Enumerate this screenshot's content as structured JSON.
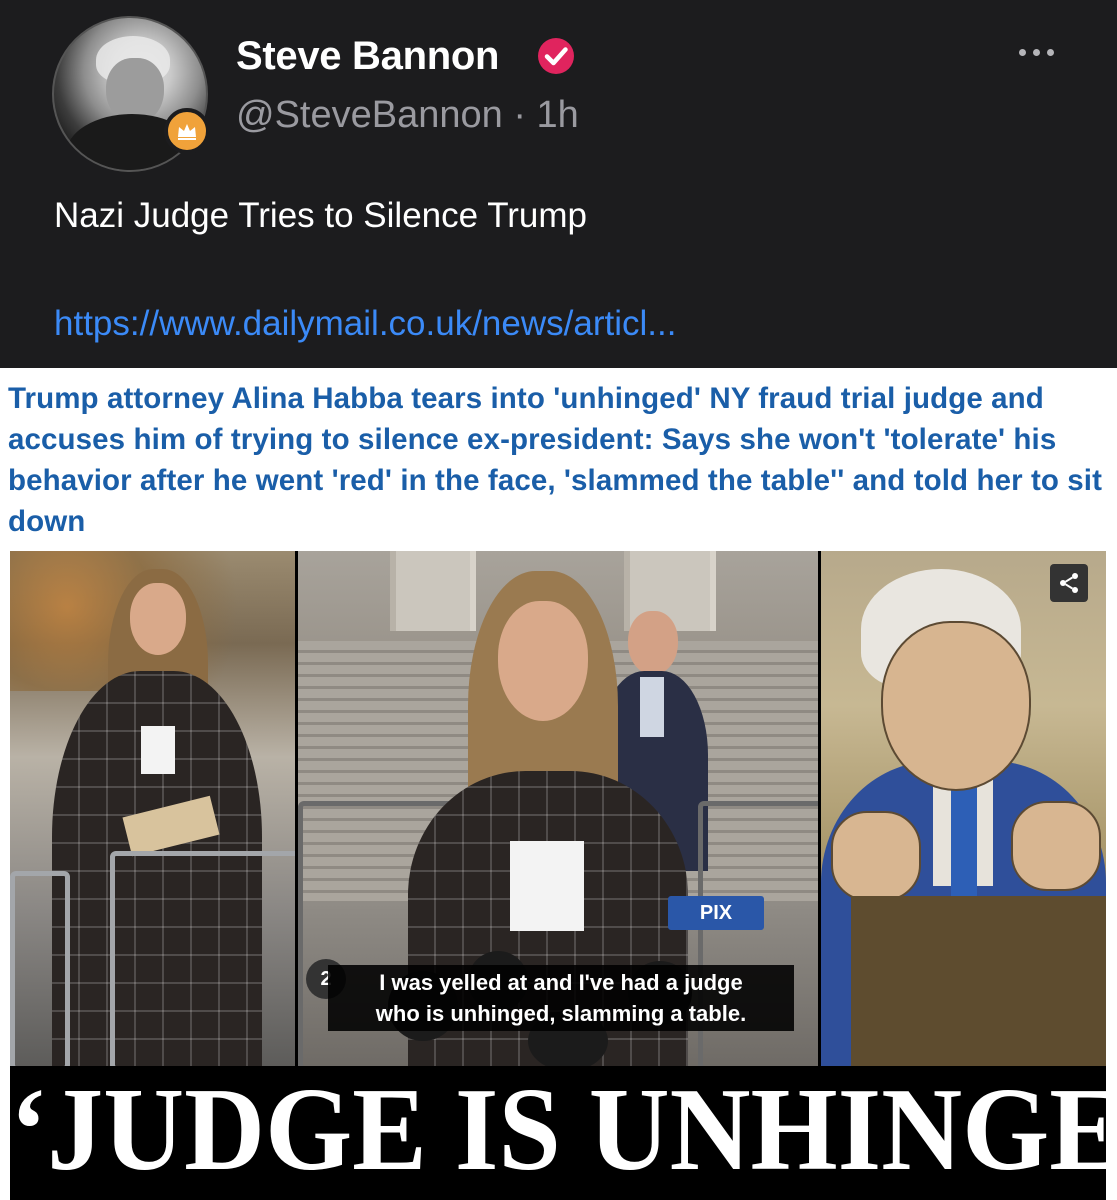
{
  "post": {
    "author_name": "Steve Bannon",
    "author_handle": "@SteveBannon",
    "separator": "·",
    "timestamp": "1h",
    "text": "Nazi Judge Tries to Silence Trump",
    "link": "https://www.dailymail.co.uk/news/articl...",
    "icons": {
      "verified": "verified-check-icon",
      "badge": "crown-badge-icon",
      "more": "more-horizontal-icon",
      "share": "share-icon"
    }
  },
  "article": {
    "headline": "Trump attorney Alina Habba tears into 'unhinged' NY fraud trial judge and accuses him of trying to silence ex-president: Says she won't 'tolerate' his behavior after he went 'red' in the face, 'slammed the table'' and told her to sit down",
    "caption_line1": "I was yelled at and I've had a judge",
    "caption_line2": "who is unhinged, slamming a table.",
    "mic_logo_1": "PIX",
    "mic_logo_2": "2",
    "banner": "‘JUDGE IS UNHINGED’"
  },
  "colors": {
    "background": "#1c1c1e",
    "link": "#3b8af7",
    "verified": "#e0245e",
    "badge": "#f0a23a",
    "headline": "#1a5ea8"
  }
}
